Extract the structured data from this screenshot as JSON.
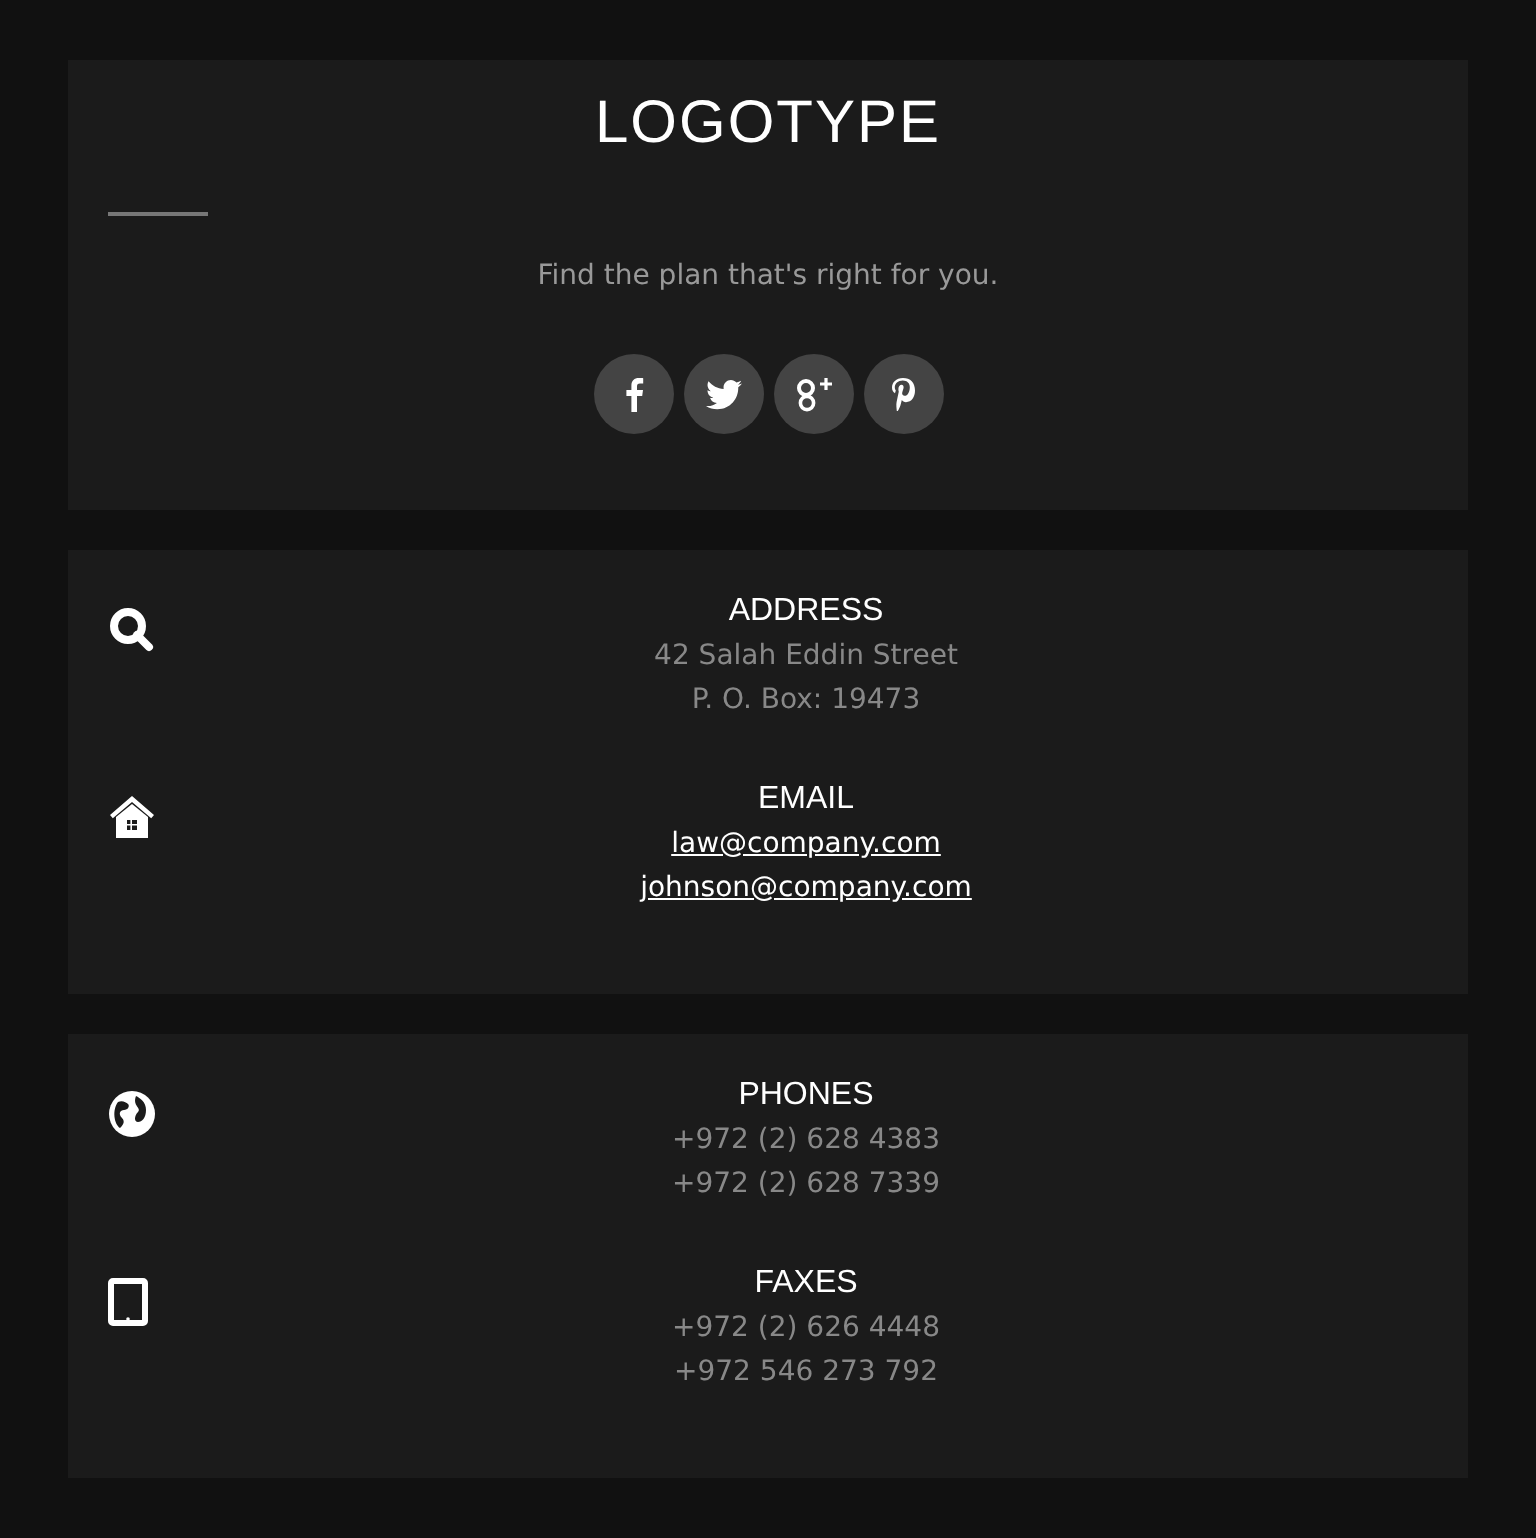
{
  "header": {
    "logo": "LOGOTYPE",
    "tagline": "Find the plan that's right for you.",
    "social": [
      {
        "kind": "facebook"
      },
      {
        "kind": "twitter"
      },
      {
        "kind": "googleplus"
      },
      {
        "kind": "pinterest"
      }
    ]
  },
  "cards": [
    {
      "blocks": [
        {
          "kind": "search",
          "heading": "ADDRESS",
          "lines": [
            {
              "kind": "text",
              "text": "42 Salah Eddin Street"
            },
            {
              "kind": "text",
              "text": "P. O. Box: 19473"
            }
          ]
        },
        {
          "kind": "home",
          "heading": "EMAIL",
          "lines": [
            {
              "kind": "link",
              "text": "law@company.com"
            },
            {
              "kind": "link",
              "text": "johnson@company.com"
            }
          ]
        }
      ]
    },
    {
      "blocks": [
        {
          "kind": "globe",
          "heading": "PHONES",
          "lines": [
            {
              "kind": "text",
              "text": "+972 (2) 628 4383"
            },
            {
              "kind": "text",
              "text": "+972 (2) 628 7339"
            }
          ]
        },
        {
          "kind": "tablet",
          "heading": "FAXES",
          "lines": [
            {
              "kind": "text",
              "text": "+972 (2) 626 4448"
            },
            {
              "kind": "text",
              "text": "+972 546 273 792"
            }
          ]
        }
      ]
    }
  ]
}
